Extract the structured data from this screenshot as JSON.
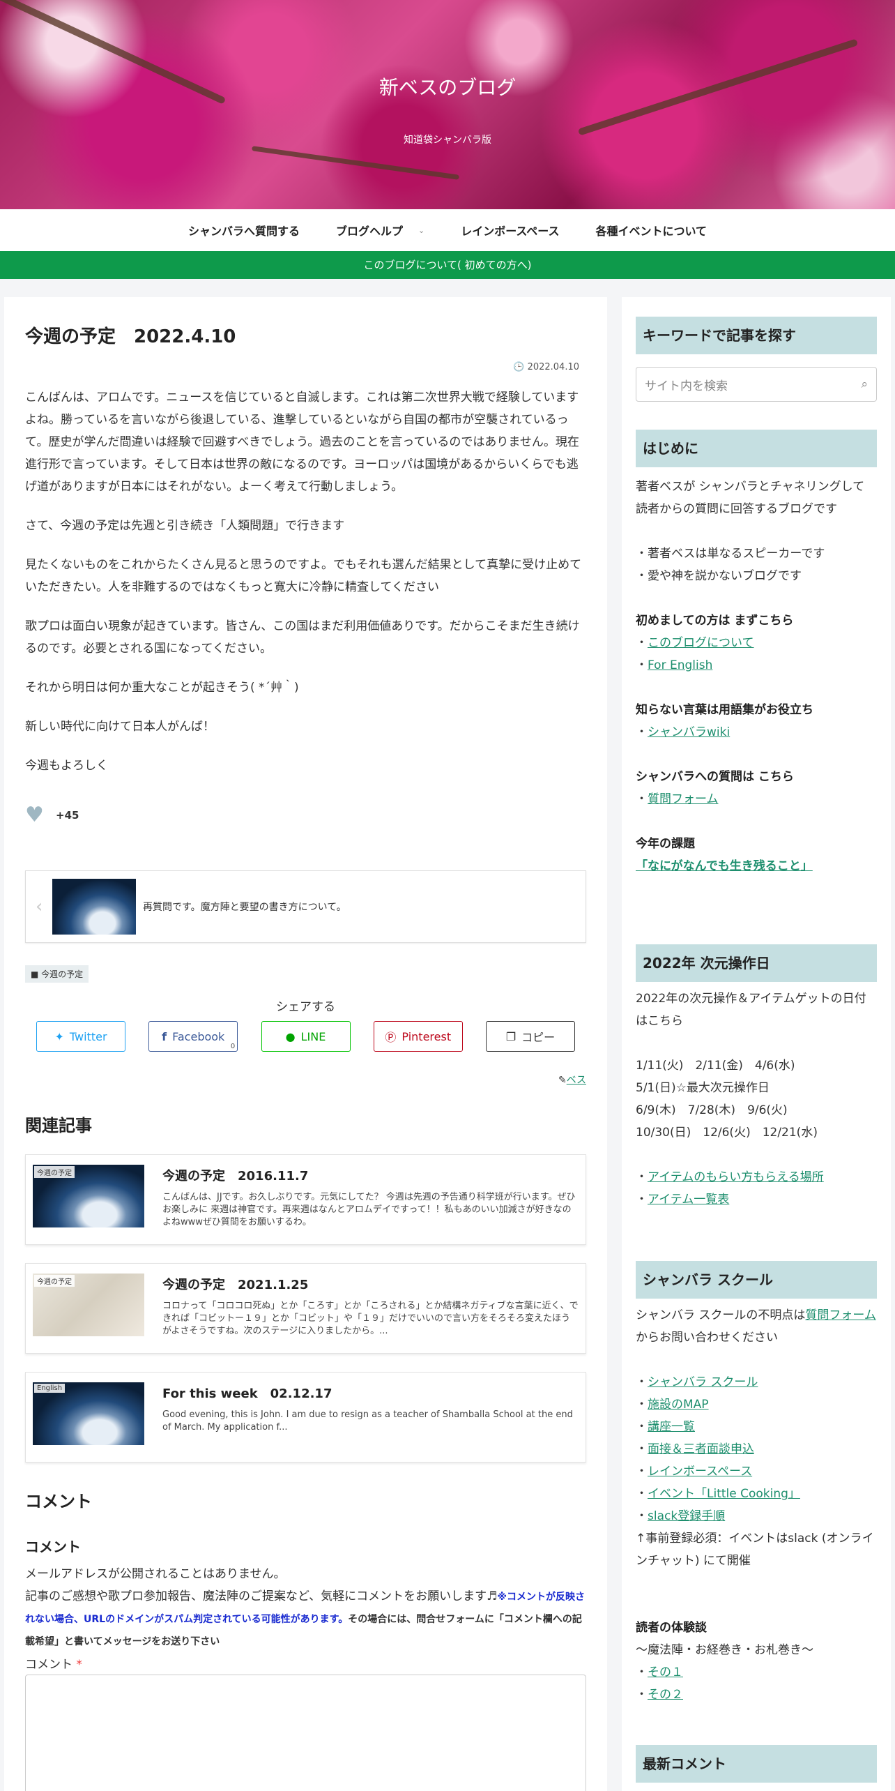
{
  "header": {
    "title": "新ベスのブログ",
    "subtitle": "知道袋シャンバラ版"
  },
  "nav": {
    "items": [
      "シャンバラへ質問する",
      "ブログヘルプ",
      "レインボースペース",
      "各種イベントについて"
    ]
  },
  "notice": "このブログについて( 初めての方へ)",
  "post": {
    "title": "今週の予定　2022.4.10",
    "date": "2022.04.10",
    "paragraphs": [
      "こんばんは、アロムです。ニュースを信じていると自滅します。これは第二次世界大戦で経験していますよね。勝っているを言いながら後退している、進撃しているといながら自国の都市が空襲されているって。歴史が学んだ間違いは経験で回避すべきでしょう。過去のことを言っているのではありません。現在進行形で言っています。そして日本は世界の敵になるのです。ヨーロッパは国境があるからいくらでも逃げ道がありますが日本にはそれがない。よーく考えて行動しましょう。",
      "さて、今週の予定は先週と引き続き「人類問題」で行きます",
      "見たくないものをこれからたくさん見ると思うのですよ。でもそれも選んだ結果として真摯に受け止めていただきたい。人を非難するのではなくもっと寛大に冷静に精査してください",
      "歌プロは面白い現象が起きています。皆さん、この国はまだ利用価値ありです。だからこそまだ生き続けるのです。必要とされる国になってください。",
      "それから明日は何か重大なことが起きそう( *´艸｀)",
      "新しい時代に向けて日本人がんば！",
      "今週もよろしく"
    ],
    "likes": "+45",
    "prev_post": "再質問です。魔方陣と要望の書き方について。",
    "tag": "今週の予定",
    "share_label": "シェアする",
    "share": {
      "twitter": "Twitter",
      "facebook": "Facebook",
      "facebook_count": "0",
      "line": "LINE",
      "pinterest": "Pinterest",
      "copy": "コピー"
    },
    "author": "ベス"
  },
  "related": {
    "heading": "関連記事",
    "items": [
      {
        "label": "今週の予定",
        "title": "今週の予定　2016.11.7",
        "desc": "こんばんは、JJです。お久しぶりです。元気にしてた？ 今週は先週の予告通り科学班が行います。ぜひお楽しみに 来週は神官です。再来週はなんとアロムデイですって！！私もあのいい加減さが好きなのよねwwwぜひ質問をお願いするわ。"
      },
      {
        "label": "今週の予定",
        "title": "今週の予定　2021.1.25",
        "desc": "コロナって「コロコロ死ぬ」とか「ころす」とか「ころされる」とか結構ネガティブな言葉に近く、できれば「コビットー１９」とか「コビット」や「１９」だけでいいので言い方をそろそろ変えたほうがよさそうですね。次のステージに入りましたから。..."
      },
      {
        "label": "English",
        "title": "For this week　02.12.17",
        "desc": "Good evening, this is John. I am due to resign as a teacher of Shamballa School at the end of March. My application f..."
      }
    ]
  },
  "comments": {
    "heading": "コメント",
    "subheading": "コメント",
    "email_note": "メールアドレスが公開されることはありません。",
    "intro": "記事のご感想や歌プロ参加報告、魔法陣のご提案など、気軽にコメントをお願いします♬",
    "warning": "※コメントが反映されない場合、URLのドメインがスパム判定されている可能性があります。",
    "warning2": "その場合には、問合せフォームに「コメント欄への記載希望」と書いてメッセージをお送り下さい",
    "field_label": "コメント",
    "required_mark": "*"
  },
  "sidebar": {
    "search_heading": "キーワードで記事を探す",
    "search_placeholder": "サイト内を検索",
    "intro_heading": "はじめに",
    "intro_text": "著者ベスが シャンバラとチャネリングして 読者からの質問に回答するブログです",
    "intro_bullets": [
      "・著者ベスは単なるスピーカーです",
      "・愛や神を説かないブログです"
    ],
    "first_heading": "初めましての方は まずこちら",
    "first_links": [
      "このブログについて",
      "For English"
    ],
    "glossary_heading": "知らない言葉は用語集がお役立ち",
    "glossary_link": "シャンバラwiki",
    "question_heading": "シャンバラへの質問は こちら",
    "question_link": "質問フォーム",
    "theme_heading": "今年の課題",
    "theme_link": "「なにがなんでも生き残ること」",
    "ops_heading": "2022年 次元操作日",
    "ops_intro": "2022年の次元操作＆アイテムゲットの日付はこちら",
    "ops_dates": [
      "1/11(火)　2/11(金)　4/6(水)",
      "5/1(日)☆最大次元操作日",
      "6/9(木)　7/28(木)　9/6(火)",
      "10/30(日)　12/6(火)　12/21(水)"
    ],
    "ops_links": [
      "アイテムのもらい方もらえる場所",
      "アイテム一覧表"
    ],
    "school_heading": "シャンバラ スクール",
    "school_intro_pre": "シャンバラ スクールの不明点は",
    "school_intro_link": "質問フォーム",
    "school_intro_post": "からお問い合わせください",
    "school_links": [
      "シャンバラ スクール",
      "施設のMAP",
      "講座一覧",
      "面接＆三者面談申込",
      "レインボースペース",
      "イベント「Little Cooking」",
      "slack登録手順"
    ],
    "school_note": "↑事前登録必須：イベントはslack (オンラインチャット) にて開催",
    "exp_heading": "読者の体験談",
    "exp_sub": "〜魔法陣・お経巻き・お札巻き〜",
    "exp_links": [
      "その１",
      "その２"
    ],
    "latest_heading": "最新コメント"
  }
}
